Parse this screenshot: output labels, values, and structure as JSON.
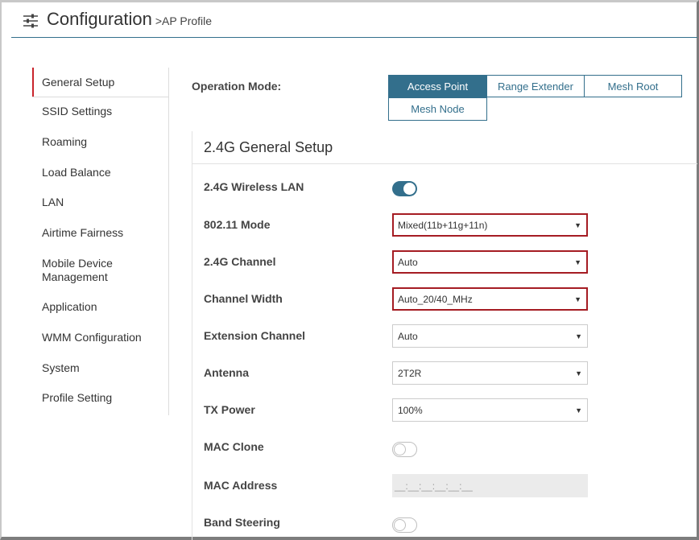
{
  "header": {
    "icon": "settings-sliders-icon",
    "title": "Configuration",
    "breadcrumb": ">AP Profile"
  },
  "sidebar": {
    "items": [
      {
        "label": "General Setup",
        "active": true
      },
      {
        "label": "SSID Settings"
      },
      {
        "label": "Roaming"
      },
      {
        "label": "Load Balance"
      },
      {
        "label": "LAN"
      },
      {
        "label": "Airtime Fairness"
      },
      {
        "label": "Mobile Device\nManagement"
      },
      {
        "label": "Application"
      },
      {
        "label": "WMM Configuration"
      },
      {
        "label": "System"
      },
      {
        "label": "Profile Setting"
      }
    ]
  },
  "operation_mode": {
    "label": "Operation Mode:",
    "selected": "Access Point",
    "options": [
      "Access Point",
      "Range Extender",
      "Mesh Root",
      "Mesh Node"
    ]
  },
  "panel": {
    "title": "2.4G General Setup",
    "rows": {
      "wireless_lan": {
        "label": "2.4G Wireless LAN",
        "value": true
      },
      "mode": {
        "label": "802.11 Mode",
        "value": "Mixed(11b+11g+11n)"
      },
      "channel": {
        "label": "2.4G Channel",
        "value": "Auto"
      },
      "channel_width": {
        "label": "Channel Width",
        "value": "Auto_20/40_MHz"
      },
      "extension_channel": {
        "label": "Extension Channel",
        "value": "Auto"
      },
      "antenna": {
        "label": "Antenna",
        "value": "2T2R"
      },
      "tx_power": {
        "label": "TX Power",
        "value": "100%"
      },
      "mac_clone": {
        "label": "MAC Clone",
        "value": false
      },
      "mac_address": {
        "label": "MAC Address",
        "placeholder": "__:__:__:__:__:__"
      },
      "band_steering": {
        "label": "Band Steering",
        "value": false
      }
    }
  },
  "colors": {
    "accent": "#336f8c",
    "error_border": "#a51c23",
    "active_marker": "#c9252c"
  }
}
